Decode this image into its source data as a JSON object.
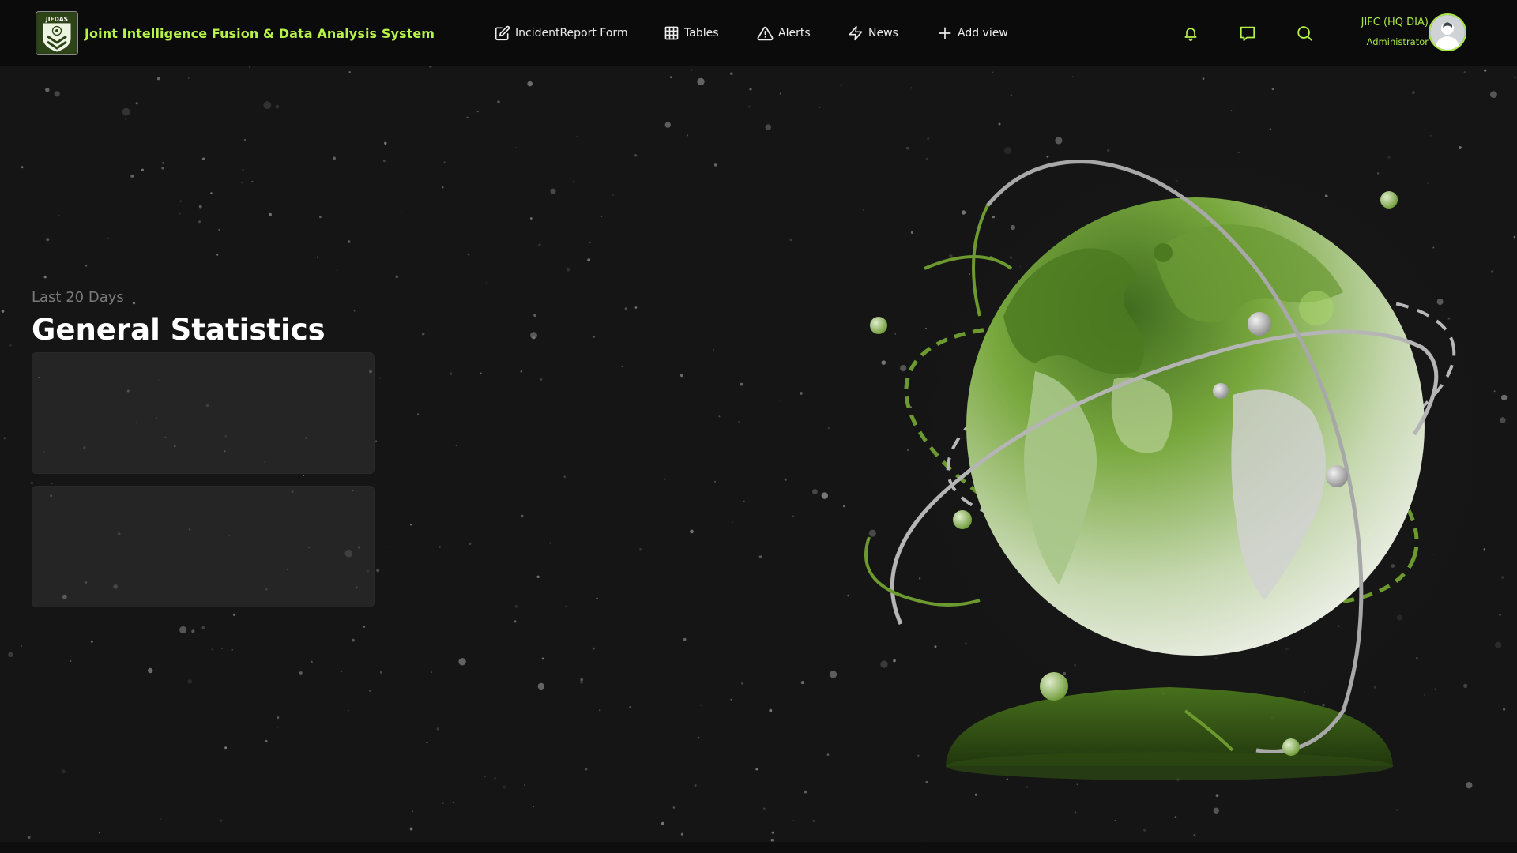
{
  "app": {
    "logo_text": "JIFDAS",
    "title": "Joint Intelligence Fusion & Data Analysis System"
  },
  "nav": {
    "items": [
      {
        "label": "IncidentReport Form",
        "icon": "edit-icon"
      },
      {
        "label": "Tables",
        "icon": "table-icon"
      },
      {
        "label": "Alerts",
        "icon": "alert-triangle-icon"
      },
      {
        "label": "News",
        "icon": "lightning-icon"
      },
      {
        "label": "Add view",
        "icon": "plus-icon"
      }
    ]
  },
  "header_actions": {
    "icons": [
      "bell-icon",
      "message-icon",
      "search-icon"
    ]
  },
  "user": {
    "name": "JIFC (HQ DIA)",
    "role": "Administrator"
  },
  "dashboard": {
    "period_label": "Last 20 Days",
    "title": "General Statistics"
  },
  "colors": {
    "accent": "#b6f24a",
    "background": "#151515",
    "header": "#0b0b0b"
  }
}
